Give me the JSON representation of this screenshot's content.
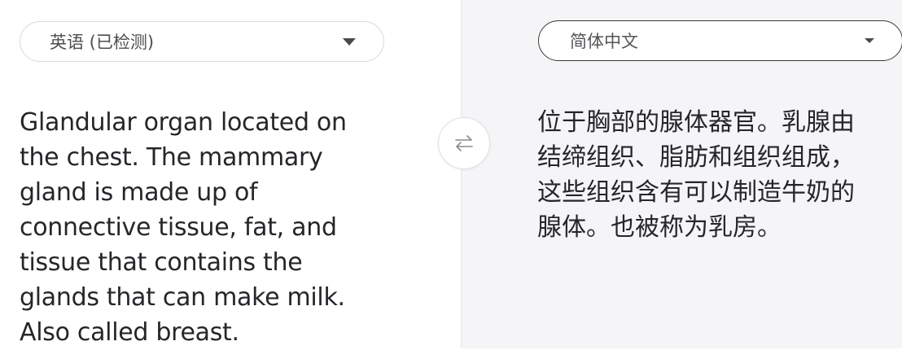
{
  "source": {
    "language_label": "英语 (已检测)",
    "text_lines": [
      "Glandular organ located on",
      "the chest. The mammary",
      "gland is made up of",
      "connective tissue, fat, and",
      "tissue that contains the",
      "glands that can make milk.",
      "Also called breast."
    ]
  },
  "target": {
    "language_label": "简体中文",
    "text_lines": [
      "位于胸部的腺体器官。乳腺由",
      "结缔组织、脂肪和组织组成，",
      "这些组织含有可以制造牛奶的",
      "腺体。也被称为乳房。"
    ]
  },
  "icons": {
    "swap": "swap-arrows-icon",
    "dropdown": "chevron-down-icon"
  },
  "colors": {
    "text": "#26262a",
    "target_pane_bg": "#f5f5f7",
    "border": "#d9d9de"
  }
}
